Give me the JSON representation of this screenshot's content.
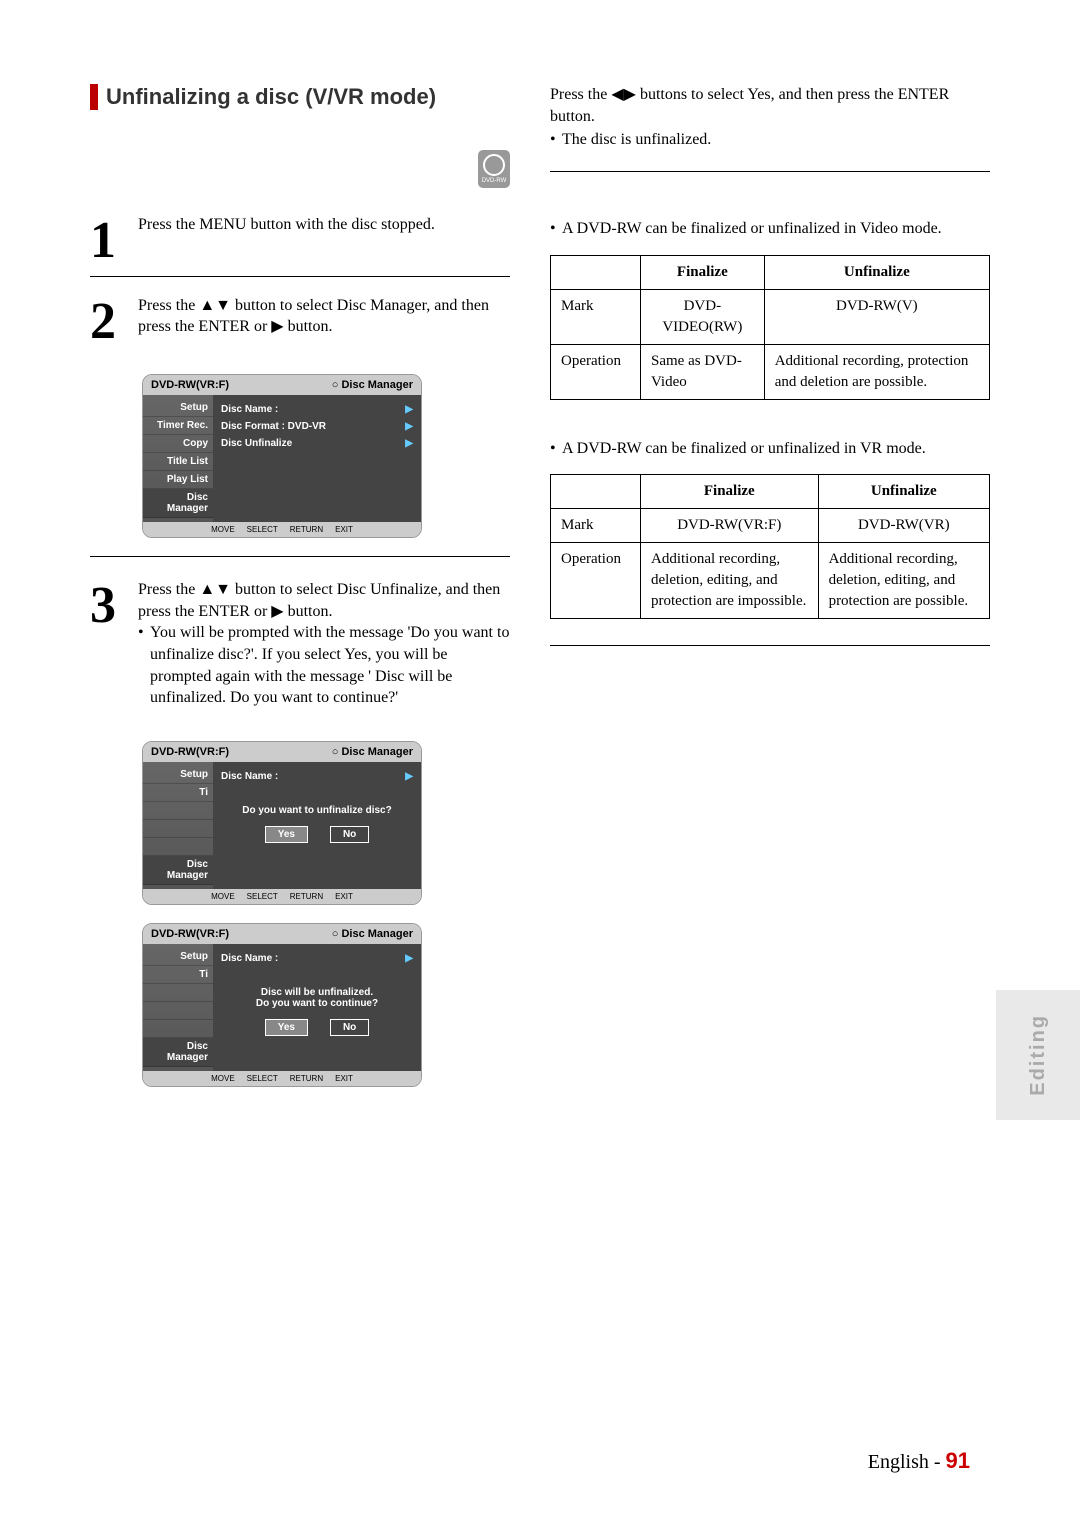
{
  "title": "Unfinalizing a disc (V/VR mode)",
  "disc_badge": "DVD-RW",
  "steps": {
    "s1": {
      "num": "1",
      "text": "Press the MENU button with the disc stopped."
    },
    "s2": {
      "num": "2",
      "text": "Press the ▲▼ button to select Disc Manager, and then press the ENTER or ▶ button."
    },
    "s3": {
      "num": "3",
      "text": "Press the ▲▼ button to select Disc Unfinalize, and then press the ENTER or ▶ button.",
      "bullet": "You will be prompted with the message 'Do you want to unfinalize disc?'. If you select Yes, you will be prompted again with the message ' Disc will be unfinalized. Do you want to continue?'"
    }
  },
  "osd": {
    "header_left": "DVD-RW(VR:F)",
    "header_right": "Disc Manager",
    "side_items": [
      "Setup",
      "Timer Rec.",
      "Copy",
      "Title List",
      "Play List",
      "Disc Manager"
    ],
    "side_item_short": "Ti",
    "rows": {
      "name": "Disc Name   :",
      "format": "Disc Format  : DVD-VR",
      "unfinalize": "Disc Unfinalize"
    },
    "dialog1": "Do you want to unfinalize disc?",
    "dialog2a": "Disc will be unfinalized.",
    "dialog2b": "Do you want to continue?",
    "btn_yes": "Yes",
    "btn_no": "No",
    "hints": {
      "move": "MOVE",
      "select": "SELECT",
      "return": "RETURN",
      "exit": "EXIT"
    }
  },
  "right": {
    "intro1": "Press the ◀▶ buttons to select Yes, and then press the ENTER button.",
    "intro2": "The disc is unfinalized.",
    "note1": "A DVD-RW can be finalized or unfinalized in Video mode.",
    "note2": "A DVD-RW can be finalized or unfinalized in VR mode.",
    "table1": {
      "head": [
        "",
        "Finalize",
        "Unfinalize"
      ],
      "r1": [
        "Mark",
        "DVD-VIDEO(RW)",
        "DVD-RW(V)"
      ],
      "r2": [
        "Operation",
        "Same as DVD-Video",
        "Additional recording, protection and deletion are possible."
      ]
    },
    "table2": {
      "head": [
        "",
        "Finalize",
        "Unfinalize"
      ],
      "r1": [
        "Mark",
        "DVD-RW(VR:F)",
        "DVD-RW(VR)"
      ],
      "r2": [
        "Operation",
        "Additional recording, deletion, editing, and protection are impossible.",
        "Additional recording, deletion, editing, and protection are possible."
      ]
    }
  },
  "side_tab": "Editing",
  "footer": {
    "lang": "English -",
    "page": "91"
  }
}
